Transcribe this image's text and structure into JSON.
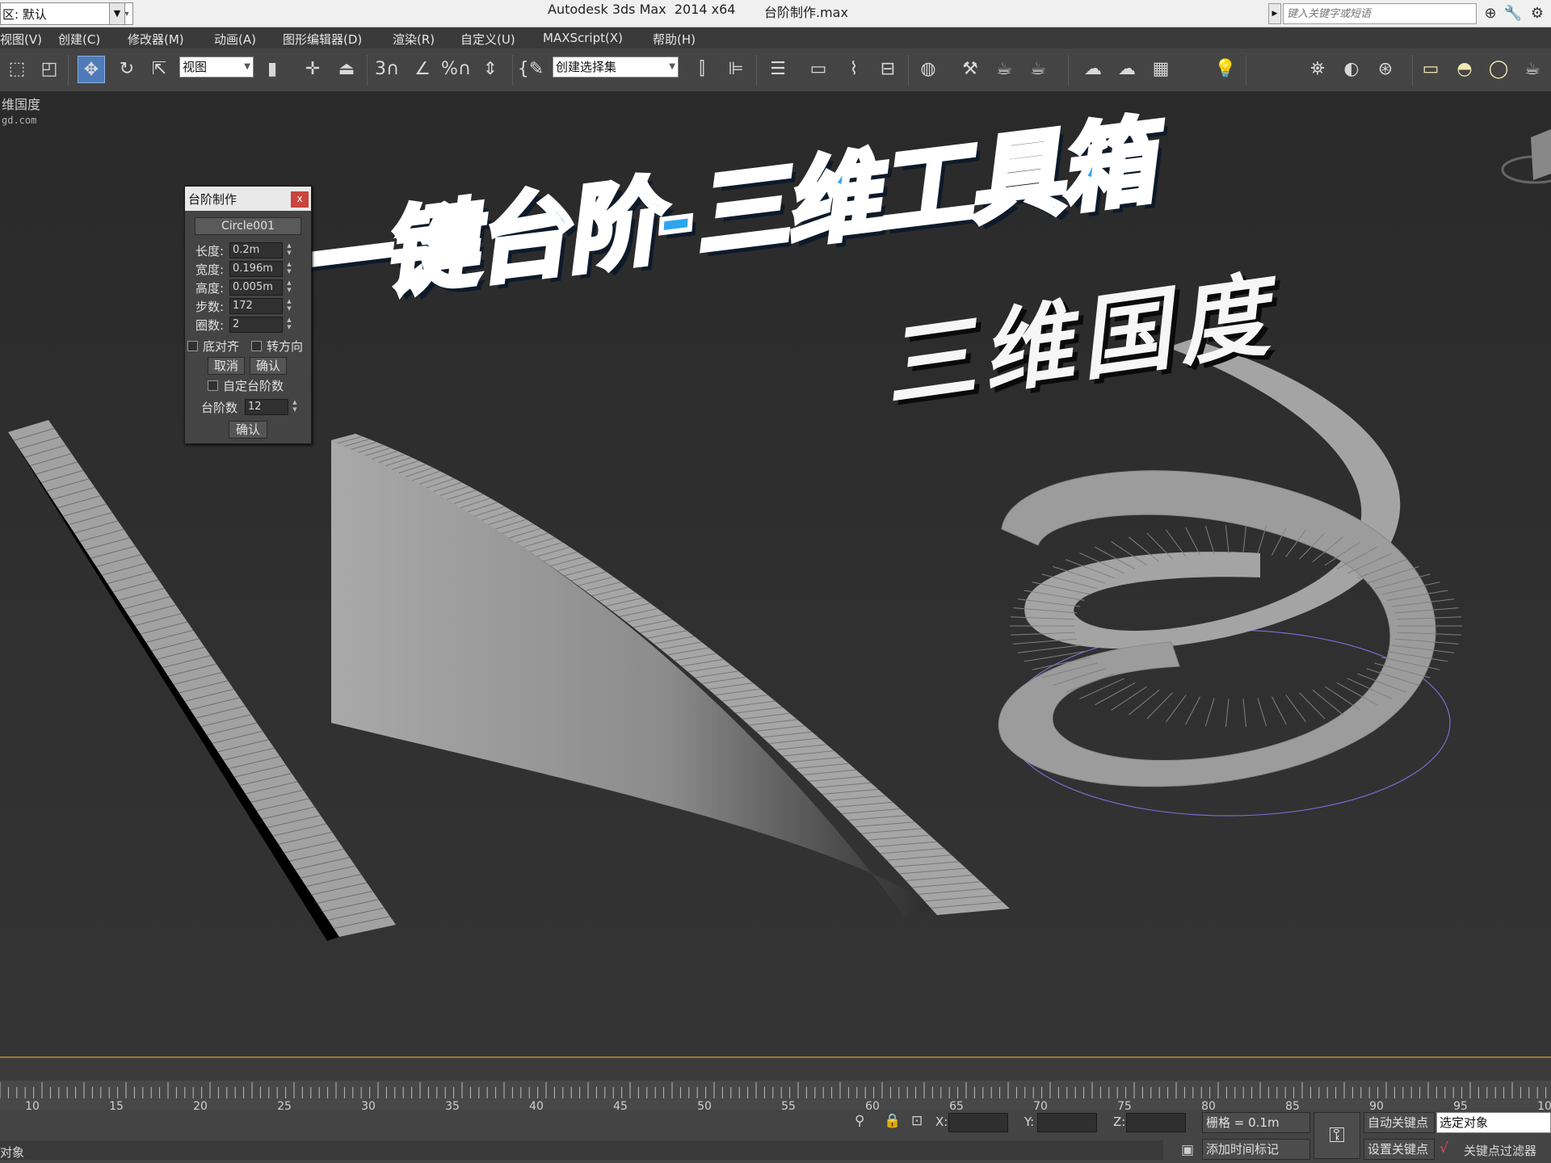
{
  "titlebar": {
    "workspace": "区: 默认",
    "app_title": "Autodesk 3ds Max  2014 x64",
    "file_title": "台阶制作.max",
    "search_placeholder": "键入关键字或短语"
  },
  "menu": [
    "视图(V)",
    "创建(C)",
    "修改器(M)",
    "动画(A)",
    "图形编辑器(D)",
    "渲染(R)",
    "自定义(U)",
    "MAXScript(X)",
    "帮助(H)"
  ],
  "toolbar": {
    "reference_coord": "视图",
    "selection_set": "创建选择集",
    "snap_3d": "3",
    "percent": "%"
  },
  "viewport": {
    "label": "维国度",
    "sub": "gd.com"
  },
  "overlay": {
    "title": "一键台阶-三维工具箱",
    "subtitle": "三维国度"
  },
  "dialog": {
    "title": "台阶制作",
    "close": "x",
    "pick_button": "Circle001",
    "fields": [
      {
        "label": "长度:",
        "value": "0.2m"
      },
      {
        "label": "宽度:",
        "value": "0.196m"
      },
      {
        "label": "高度:",
        "value": "0.005m"
      },
      {
        "label": "步数:",
        "value": "172"
      },
      {
        "label": "圈数:",
        "value": "2"
      }
    ],
    "bottom_align": "底对齐",
    "reverse": "转方向",
    "cancel": "取消",
    "confirm": "确认",
    "custom_steps": "自定台阶数",
    "steps_label": "台阶数",
    "steps_value": "12",
    "confirm2": "确认"
  },
  "timeline": {
    "ticks": [
      "10",
      "15",
      "20",
      "25",
      "30",
      "35",
      "40",
      "45",
      "50",
      "55",
      "60",
      "65",
      "70",
      "75",
      "80",
      "85",
      "90",
      "95",
      "10"
    ]
  },
  "status": {
    "selection": "对象",
    "x_label": "X:",
    "y_label": "Y:",
    "z_label": "Z:",
    "grid": "栅格 = 0.1m",
    "add_time_tag": "添加时间标记",
    "auto_key": "自动关键点",
    "set_key": "设置关键点",
    "key_target": "选定对象",
    "key_filter": "关键点过滤器"
  },
  "colors": {
    "viewport_bg": "#2d2d2d",
    "title_blue": "#2ea5f0",
    "active_tool": "#4f7bb8",
    "helper_circle": "#7a6ad0"
  }
}
